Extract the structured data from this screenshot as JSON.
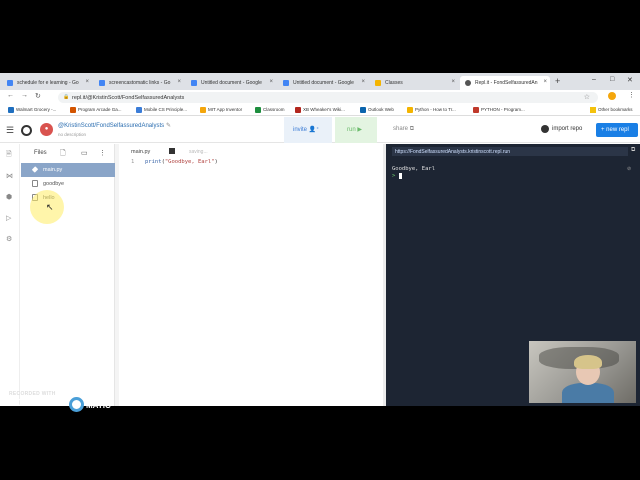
{
  "browser": {
    "tabs": [
      {
        "title": "schedule for e learning - Go",
        "color": "#4285f4"
      },
      {
        "title": "screencastomatic links - Go",
        "color": "#4285f4"
      },
      {
        "title": "Untitled document - Google",
        "color": "#4285f4"
      },
      {
        "title": "Untitled document - Google",
        "color": "#4285f4"
      },
      {
        "title": "Classes",
        "color": "#f4b400"
      },
      {
        "title": "Repl.it - FondSelfassuredAn",
        "color": "#555555"
      }
    ],
    "url": "repl.it/@KristinScott/FondSelfassuredAnalysts",
    "bookmarks": [
      {
        "label": "Walmart Grocery -...",
        "color": "#1f6fbf"
      },
      {
        "label": "Program Arcade Ga...",
        "color": "#d35400"
      },
      {
        "label": "Mobile CS Principle...",
        "color": "#3b7dd8"
      },
      {
        "label": "MIT App Inventor",
        "color": "#f4a60c"
      },
      {
        "label": "Classroom",
        "color": "#1e8e3e"
      },
      {
        "label": "XB Wheaker's Wiki...",
        "color": "#b3261e"
      },
      {
        "label": "Outlook Web",
        "color": "#0a64ad"
      },
      {
        "label": "Python - How to Tr...",
        "color": "#f4b400"
      },
      {
        "label": "PYTHON - Program...",
        "color": "#c0392b"
      }
    ],
    "other_bookmarks": "Other bookmarks"
  },
  "header": {
    "repo_name": "@KristinScott/FondSelfassuredAnalysts",
    "description": "no description",
    "invite_label": "invite",
    "run_label": "run",
    "share_label": "share",
    "import_label": "import repo",
    "new_repl_label": "+ new repl"
  },
  "files": {
    "title": "Files",
    "items": [
      {
        "name": "main.py",
        "active": true
      },
      {
        "name": "goodbye",
        "active": false
      },
      {
        "name": "hello",
        "active": false
      }
    ]
  },
  "editor": {
    "tab_name": "main.py",
    "status": "saving...",
    "line_number": "1",
    "code_fn": "print",
    "code_open": "(",
    "code_str": "\"Goodbye, Earl\"",
    "code_close": ")"
  },
  "console": {
    "url": "https://FondSelfassuredAnalysts.kristinscott.repl.run",
    "output": "Goodbye, Earl",
    "prompt": ">"
  },
  "watermark": {
    "line1": "RECORDED WITH",
    "line2a": "SCREENCAST",
    "line2b": "MATIC"
  }
}
